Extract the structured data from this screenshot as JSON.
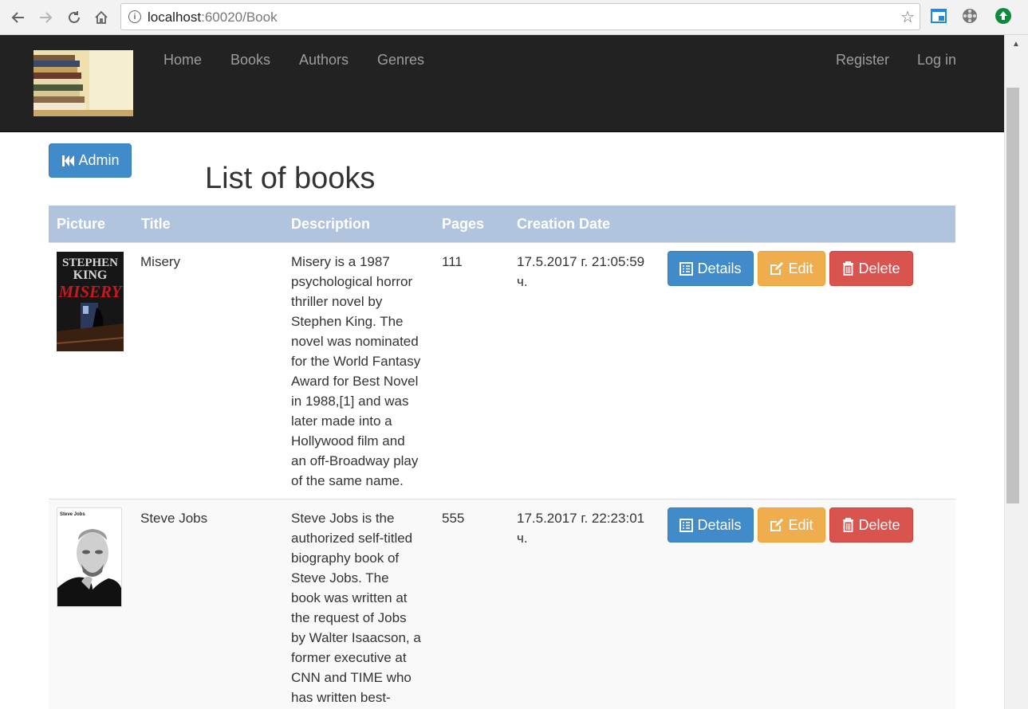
{
  "browser": {
    "url_host": "localhost",
    "url_port": ":60020",
    "url_path": "/Book",
    "colors": {
      "chrome_bg": "#f2f2f2"
    }
  },
  "navbar": {
    "links": [
      "Home",
      "Books",
      "Authors",
      "Genres"
    ],
    "register_label": "Register",
    "login_label": "Log in",
    "bg_color": "#222222"
  },
  "admin_button_label": "Admin",
  "page_title": "List of books",
  "table": {
    "headers": [
      "Picture",
      "Title",
      "Description",
      "Pages",
      "Creation Date"
    ],
    "header_bg": "#b0c4de",
    "rows": [
      {
        "cover_icon": "misery-book-cover",
        "cover_text": [
          "STEPHEN",
          "KING",
          "MISERY"
        ],
        "title": "Misery",
        "description_lines": [
          "Misery is a 1987",
          "psychological horror",
          "thriller novel by",
          "Stephen King. The",
          "novel was nominated",
          "for the World Fantasy",
          "Award for Best Novel",
          "in 1988,[1] and was",
          "later made into a",
          "Hollywood film and",
          "an off-Broadway play",
          "of the same name."
        ],
        "pages": "111",
        "creation_date_lines": [
          "17.5.2017 г. 21:05:59",
          "ч."
        ]
      },
      {
        "cover_icon": "steve-jobs-book-cover",
        "cover_text": [
          "Steve Jobs"
        ],
        "title": "Steve Jobs",
        "description_lines": [
          "Steve Jobs is the",
          "authorized self-titled",
          "biography book of",
          "Steve Jobs. The",
          "book was written at",
          "the request of Jobs",
          "by Walter Isaacson, a",
          "former executive at",
          "CNN and TIME who",
          "has written best-"
        ],
        "pages": "555",
        "creation_date_lines": [
          "17.5.2017 г. 22:23:01",
          "ч."
        ]
      }
    ],
    "actions": {
      "details_label": "Details",
      "edit_label": "Edit",
      "delete_label": "Delete",
      "colors": {
        "details": "#428bca",
        "edit": "#f0ad4e",
        "delete": "#d9534f"
      }
    }
  }
}
